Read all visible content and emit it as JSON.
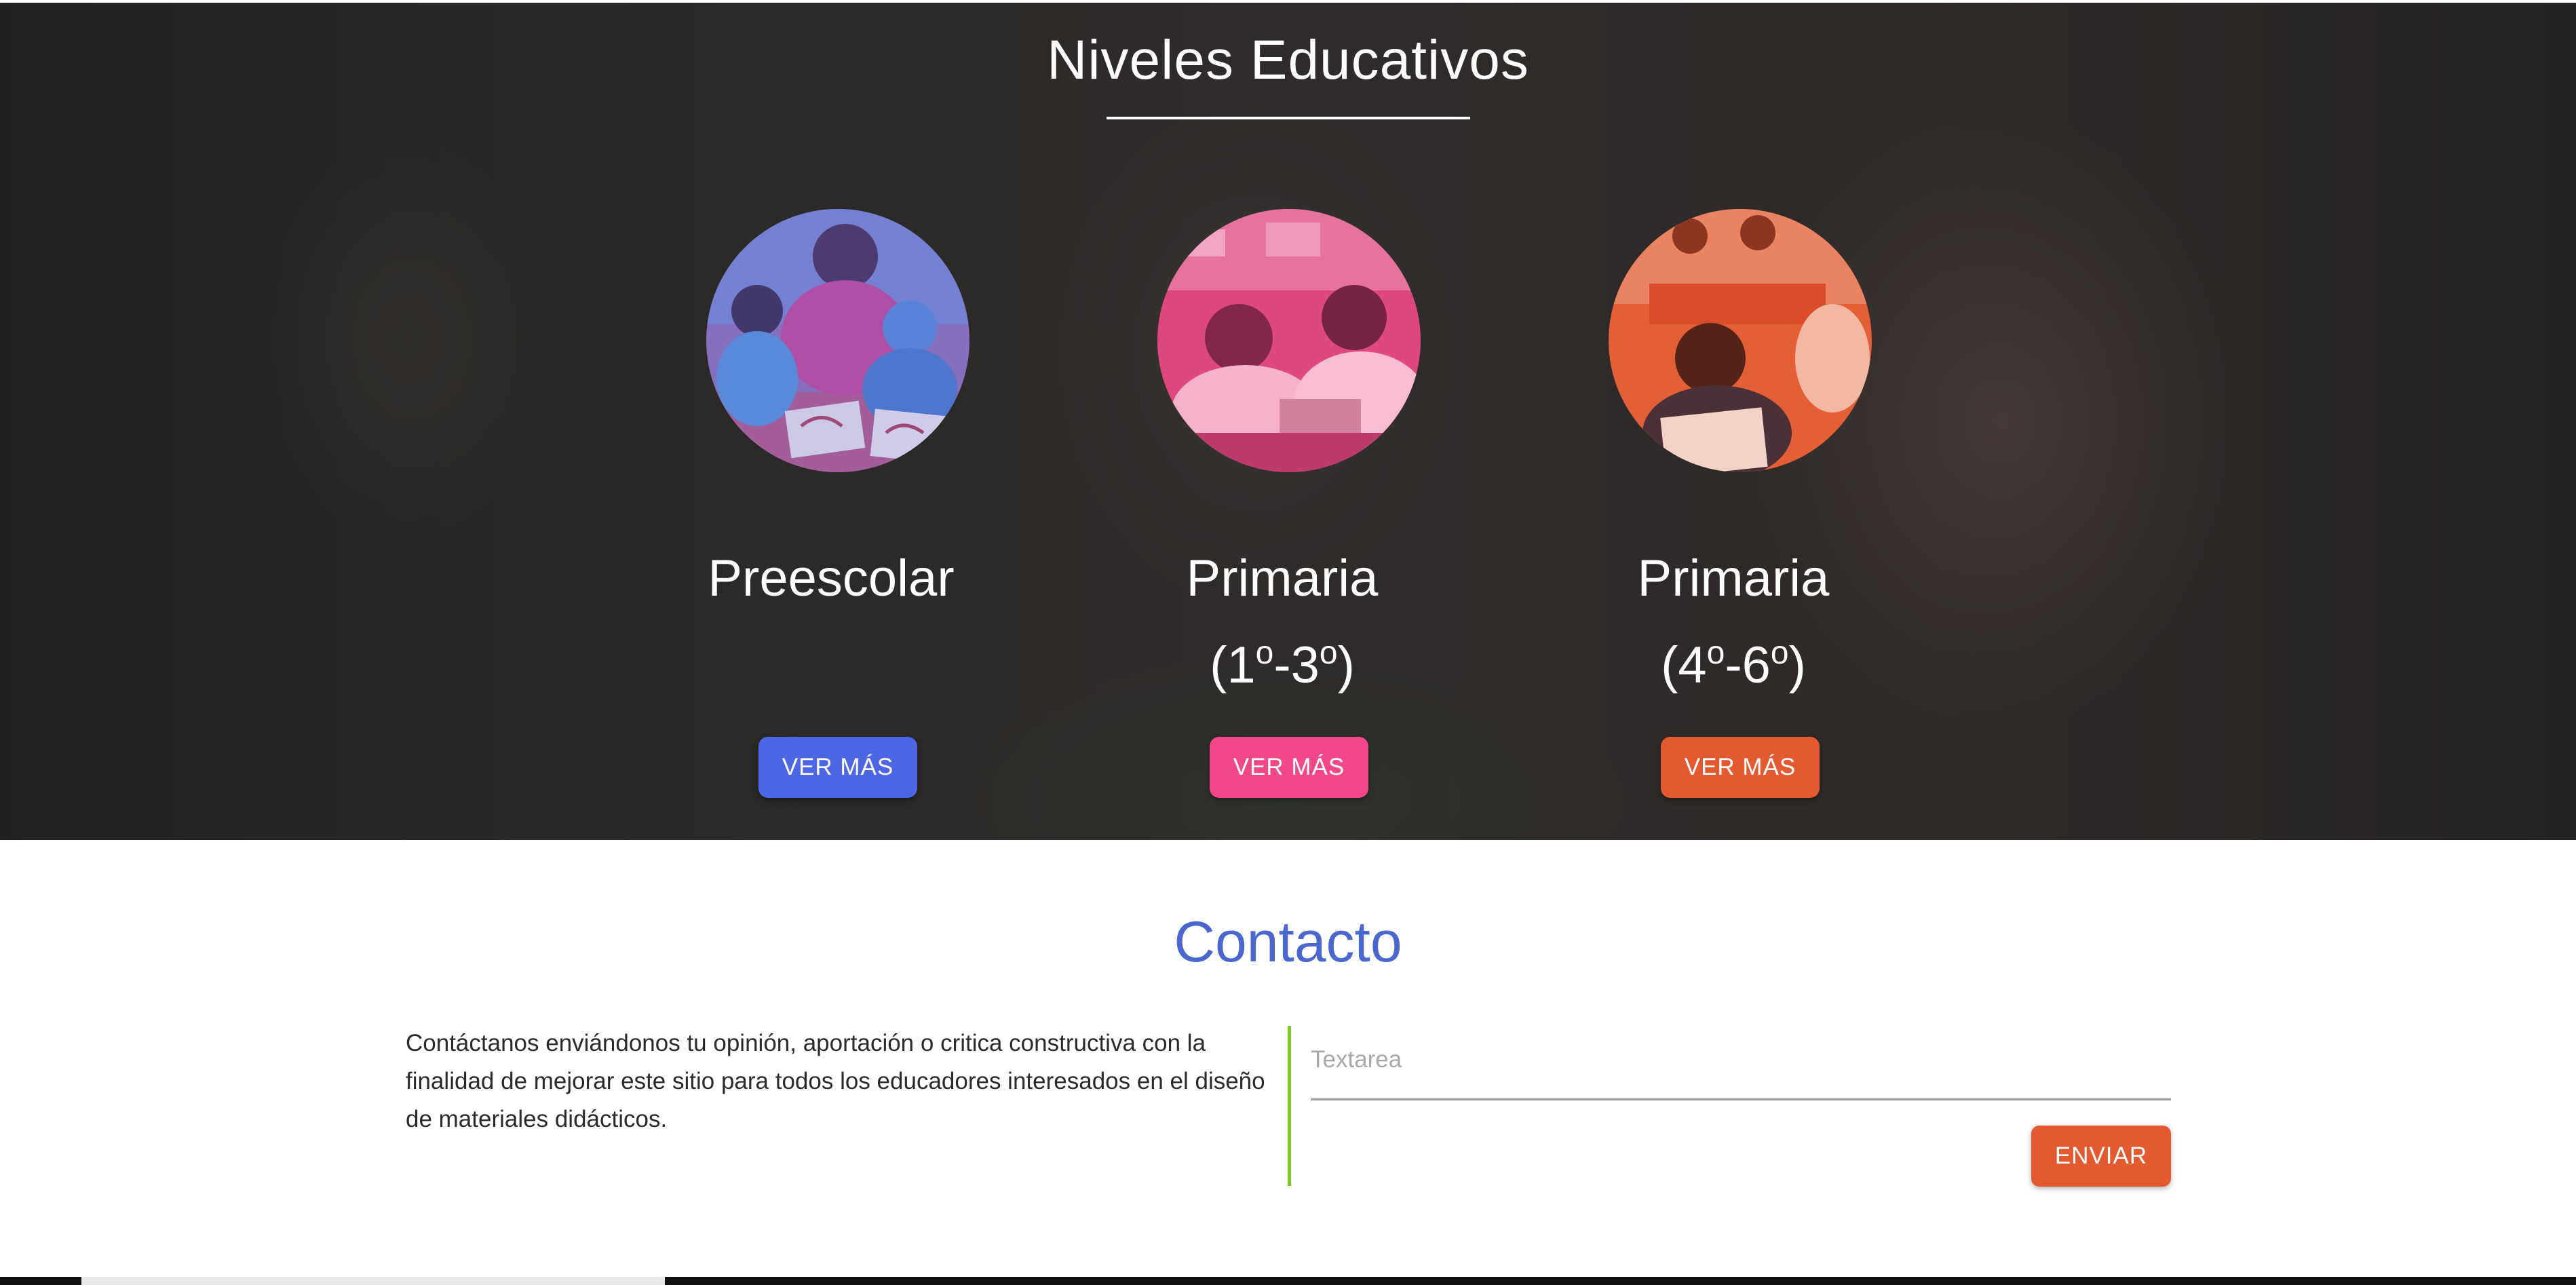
{
  "levels_section": {
    "title": "Niveles Educativos",
    "levels": [
      {
        "name": "Preescolar",
        "sub": "",
        "button": "VER MÁS",
        "accent": "#4c66e4"
      },
      {
        "name": "Primaria",
        "sub_open": "(1",
        "sub_sup1": "o",
        "sub_mid": "-3",
        "sub_sup2": "o",
        "sub_close": ")",
        "button": "VER MÁS",
        "accent": "#f24789"
      },
      {
        "name": "Primaria",
        "sub_open": "(4",
        "sub_sup1": "o",
        "sub_mid": "-6",
        "sub_sup2": "o",
        "sub_close": ")",
        "button": "VER MÁS",
        "accent": "#e45a30"
      }
    ]
  },
  "contact": {
    "title": "Contacto",
    "description": "Contáctanos enviándonos tu opinión, aportación o critica constructiva con la finalidad de mejorar este sitio para todos los educadores interesados en el diseño de materiales didácticos.",
    "textarea_placeholder": "Textarea",
    "submit_label": "ENVIAR",
    "title_color": "#4a67d0",
    "divider_color": "#7ccc2a"
  }
}
